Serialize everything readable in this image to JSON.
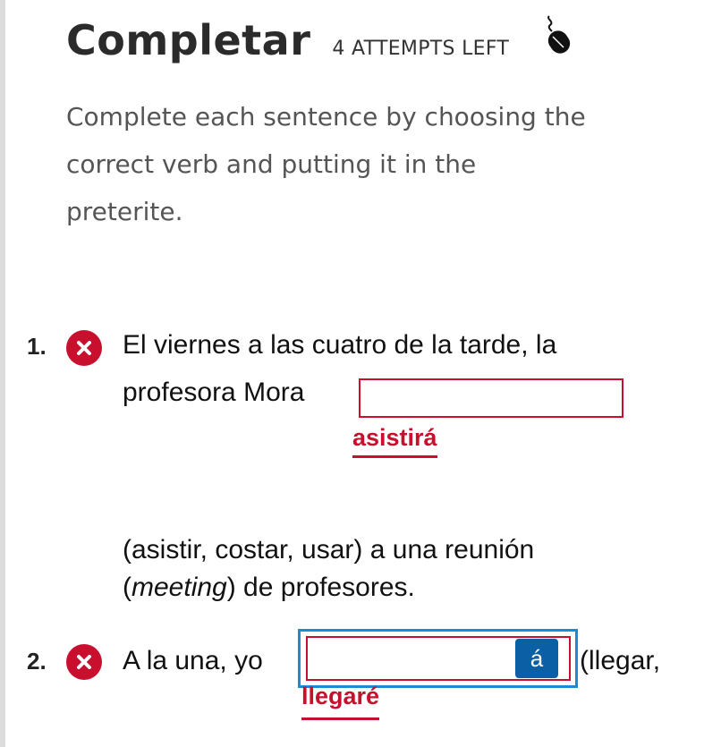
{
  "header": {
    "title": "Completar",
    "attempts_label": "4 ATTEMPTS LEFT"
  },
  "instructions": {
    "lines": [
      "Complete each sentence by choosing the",
      "correct verb and putting it in the",
      "preterite."
    ]
  },
  "questions": [
    {
      "number": "1.",
      "status": "incorrect",
      "text_line1": "El viernes a las cuatro de la tarde, la",
      "text_before_blank": "profesora Mora",
      "answer_value": "",
      "correct_answer": "asistirá",
      "text_after_line1": "(asistir, costar, usar) a una reunión",
      "text_after_line2_em": "meeting",
      "text_after_line2_rest": ") de profesores."
    },
    {
      "number": "2.",
      "status": "incorrect",
      "text_before_blank": "A la una, yo",
      "answer_value": "",
      "accent_button_label": "á",
      "text_after_blank": "(llegar,",
      "correct_answer": "llegaré"
    }
  ],
  "icons": {
    "incorrect": "x-circle-icon",
    "cursor": "mouse-cursor-icon"
  },
  "colors": {
    "error": "#c8102e",
    "focus": "#1a8bd6",
    "accent_button": "#0b5fa5"
  }
}
